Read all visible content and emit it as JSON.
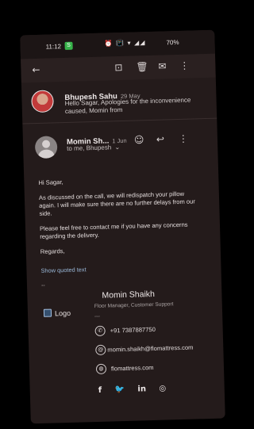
{
  "status_bar": {
    "time": "11:12",
    "app_badge": "S",
    "icons": "⏰ 📳 ▾ ◢◢",
    "battery": "70%"
  },
  "toolbar": {
    "back_icon": "arrow-left-icon",
    "archive_icon": "archive-icon",
    "delete_icon": "trash-icon",
    "mark_unread_icon": "mail-icon",
    "more_icon": "more-vertical-icon"
  },
  "collapsed_message": {
    "sender": "Bhupesh Sahu",
    "date": "29 May",
    "snippet": "Hello Sagar, Apologies for the inconvenience caused, Momin from"
  },
  "expanded_message": {
    "sender": "Momin Sh...",
    "date": "1 Jun",
    "to_line": "to me, Bhupesh",
    "body": [
      "Hi Sagar,",
      "As discussed on the call, we will redispatch your pillow again. I will make sure there are no further delays from our side.",
      "Please feel free to contact me if you have any concerns regarding the delivery.",
      "Regards,"
    ],
    "show_quoted": "Show quoted text",
    "dash": "--"
  },
  "signature": {
    "logo_alt": "Logo",
    "name": "Momin Shaikh",
    "role": "Floor Manager, Customer Support",
    "dash": "__",
    "phone": "+91 7387887750",
    "email": "momin.shaikh@flomattress.com",
    "website": "flomattress.com",
    "social": [
      "f",
      "🐦",
      "in",
      "◎"
    ]
  },
  "colors": {
    "background": "#241b1b",
    "link": "#9ab8d8"
  }
}
